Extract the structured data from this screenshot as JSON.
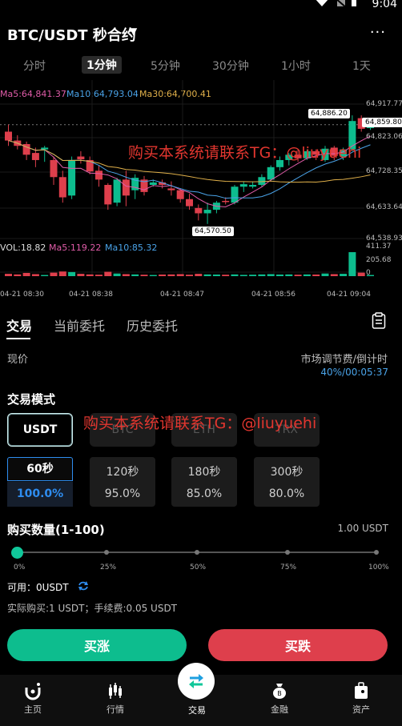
{
  "status": {
    "time": "9:04"
  },
  "header": {
    "title": "BTC/USDT 秒合约"
  },
  "tabs": [
    "分时",
    "1分钟",
    "5分钟",
    "30分钟",
    "1小时",
    "1天"
  ],
  "active_tab": "1分钟",
  "ma": {
    "ma5": "Ma5:64,841.37",
    "ma10": "Ma10:64,793.04",
    "ma30": "Ma30:64,700.41"
  },
  "vol": {
    "vol": "VOL:18.82",
    "ma5": "Ma5:119.22",
    "ma10": "Ma10:85.32"
  },
  "price_axis": [
    "64,917.77",
    "64,859.80",
    "64,823.06",
    "64,728.35",
    "64,633.64",
    "64,538.93"
  ],
  "vol_axis": [
    "411.37",
    "205.68",
    "0"
  ],
  "price_callouts": {
    "high": "64,886.20",
    "low": "64,570.50",
    "current": "64,859.80"
  },
  "time_axis": [
    "04-21 08:30",
    "04-21 08:38",
    "04-21 08:47",
    "04-21 08:56",
    "04-21 09:04"
  ],
  "watermark": "购买本系统请联系TG：@liuyuehi",
  "subtabs": [
    "交易",
    "当前委托",
    "历史委托"
  ],
  "price_label": "现价",
  "fee_label": "市场调节费/倒计时",
  "fee_value": "40%/00:05:37",
  "mode_label": "交易模式",
  "modes": [
    "USDT",
    "BTC",
    "ETH",
    "TRX"
  ],
  "periods": [
    {
      "time": "60秒",
      "pct": "100.0%"
    },
    {
      "time": "120秒",
      "pct": "95.0%"
    },
    {
      "time": "180秒",
      "pct": "85.0%"
    },
    {
      "time": "300秒",
      "pct": "80.0%"
    }
  ],
  "qty_label": "购买数量(1-100)",
  "qty_value": "1.00 USDT",
  "slider_marks": [
    "0%",
    "25%",
    "50%",
    "75%",
    "100%"
  ],
  "slider_level": 0,
  "available": "可用：0USDT",
  "actual": "实际购买:1 USDT；手续费:0.05 USDT",
  "buy_up": "买涨",
  "buy_down": "买跌",
  "nav": [
    "主页",
    "行情",
    "交易",
    "金融",
    "资产"
  ],
  "colors": {
    "up": "#0dbd8e",
    "down": "#de3f4c",
    "accent": "#2e8df0",
    "ma5": "#e05ca8",
    "ma10": "#4aa3e8",
    "ma30": "#e0b04a",
    "watermark": "#e2362f"
  },
  "candles": [
    {
      "o": 64840,
      "h": 64860,
      "l": 64800,
      "c": 64815
    },
    {
      "o": 64815,
      "h": 64830,
      "l": 64790,
      "c": 64800
    },
    {
      "o": 64805,
      "h": 64812,
      "l": 64760,
      "c": 64775
    },
    {
      "o": 64780,
      "h": 64795,
      "l": 64740,
      "c": 64760
    },
    {
      "o": 64790,
      "h": 64800,
      "l": 64755,
      "c": 64795
    },
    {
      "o": 64760,
      "h": 64770,
      "l": 64690,
      "c": 64712
    },
    {
      "o": 64712,
      "h": 64730,
      "l": 64640,
      "c": 64655
    },
    {
      "o": 64660,
      "h": 64770,
      "l": 64650,
      "c": 64760
    },
    {
      "o": 64770,
      "h": 64785,
      "l": 64750,
      "c": 64762
    },
    {
      "o": 64760,
      "h": 64770,
      "l": 64720,
      "c": 64728
    },
    {
      "o": 64730,
      "h": 64745,
      "l": 64685,
      "c": 64705
    },
    {
      "o": 64690,
      "h": 64695,
      "l": 64620,
      "c": 64635
    },
    {
      "o": 64640,
      "h": 64710,
      "l": 64630,
      "c": 64705
    },
    {
      "o": 64705,
      "h": 64730,
      "l": 64630,
      "c": 64660
    },
    {
      "o": 64675,
      "h": 64720,
      "l": 64650,
      "c": 64710
    },
    {
      "o": 64705,
      "h": 64715,
      "l": 64660,
      "c": 64670
    },
    {
      "o": 64690,
      "h": 64705,
      "l": 64685,
      "c": 64697
    },
    {
      "o": 64697,
      "h": 64705,
      "l": 64680,
      "c": 64690
    },
    {
      "o": 64680,
      "h": 64700,
      "l": 64660,
      "c": 64675
    },
    {
      "o": 64675,
      "h": 64680,
      "l": 64640,
      "c": 64650
    },
    {
      "o": 64650,
      "h": 64665,
      "l": 64620,
      "c": 64630
    },
    {
      "o": 64625,
      "h": 64635,
      "l": 64590,
      "c": 64610
    },
    {
      "o": 64610,
      "h": 64640,
      "l": 64580,
      "c": 64620
    },
    {
      "o": 64620,
      "h": 64645,
      "l": 64610,
      "c": 64640
    },
    {
      "o": 64645,
      "h": 64655,
      "l": 64635,
      "c": 64642
    },
    {
      "o": 64640,
      "h": 64690,
      "l": 64635,
      "c": 64685
    },
    {
      "o": 64685,
      "h": 64700,
      "l": 64670,
      "c": 64692
    },
    {
      "o": 64685,
      "h": 64700,
      "l": 64680,
      "c": 64690
    },
    {
      "o": 64690,
      "h": 64720,
      "l": 64685,
      "c": 64712
    },
    {
      "o": 64705,
      "h": 64745,
      "l": 64700,
      "c": 64740
    },
    {
      "o": 64740,
      "h": 64770,
      "l": 64730,
      "c": 64760
    },
    {
      "o": 64760,
      "h": 64780,
      "l": 64745,
      "c": 64775
    },
    {
      "o": 64775,
      "h": 64790,
      "l": 64755,
      "c": 64765
    },
    {
      "o": 64765,
      "h": 64790,
      "l": 64760,
      "c": 64785
    },
    {
      "o": 64785,
      "h": 64790,
      "l": 64760,
      "c": 64775
    },
    {
      "o": 64760,
      "h": 64800,
      "l": 64755,
      "c": 64792
    },
    {
      "o": 64795,
      "h": 64800,
      "l": 64760,
      "c": 64772
    },
    {
      "o": 64770,
      "h": 64795,
      "l": 64760,
      "c": 64790
    },
    {
      "o": 64790,
      "h": 64886,
      "l": 64785,
      "c": 64870
    },
    {
      "o": 64878,
      "h": 64886,
      "l": 64840,
      "c": 64848
    },
    {
      "o": 64850,
      "h": 64862,
      "l": 64845,
      "c": 64859
    }
  ],
  "volumes": [
    40,
    30,
    55,
    35,
    20,
    60,
    80,
    70,
    40,
    30,
    25,
    75,
    45,
    35,
    30,
    25,
    20,
    28,
    30,
    35,
    25,
    40,
    30,
    28,
    25,
    30,
    22,
    25,
    30,
    35,
    28,
    30,
    25,
    30,
    28,
    45,
    35,
    40,
    411,
    60,
    20
  ]
}
